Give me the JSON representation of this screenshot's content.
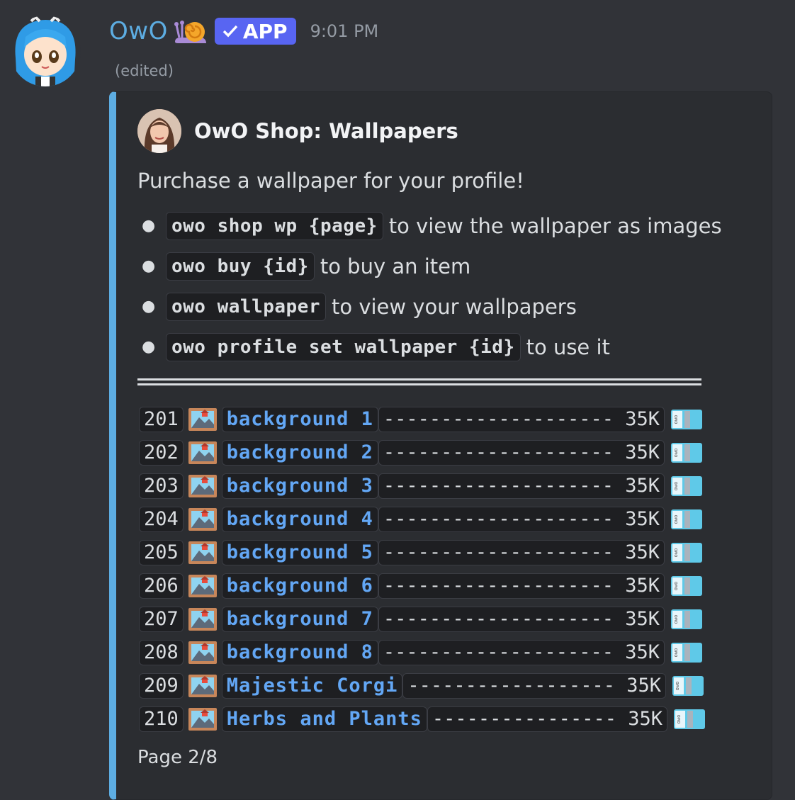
{
  "message": {
    "username": "OwO",
    "badge": "APP",
    "timestamp": "9:01 PM",
    "edited": "(edited)"
  },
  "embed": {
    "author": "OwO Shop: Wallpapers",
    "description": "Purchase a wallpaper for your profile!",
    "bullets": [
      {
        "code": "owo shop wp {page}",
        "text": "to view the wallpaper as images"
      },
      {
        "code": "owo buy {id}",
        "text": "to buy an item"
      },
      {
        "code": "owo wallpaper",
        "text": "to view your wallpapers"
      },
      {
        "code": "owo profile set wallpaper {id}",
        "text": "to use it"
      }
    ],
    "items": [
      {
        "id": "201",
        "name": "background 1",
        "dashes": "-------------------- 35K"
      },
      {
        "id": "202",
        "name": "background 2",
        "dashes": "-------------------- 35K"
      },
      {
        "id": "203",
        "name": "background 3",
        "dashes": "-------------------- 35K"
      },
      {
        "id": "204",
        "name": "background 4",
        "dashes": "-------------------- 35K"
      },
      {
        "id": "205",
        "name": "background 5",
        "dashes": "-------------------- 35K"
      },
      {
        "id": "206",
        "name": "background 6",
        "dashes": "-------------------- 35K"
      },
      {
        "id": "207",
        "name": "background 7",
        "dashes": "-------------------- 35K"
      },
      {
        "id": "208",
        "name": "background 8",
        "dashes": "-------------------- 35K"
      },
      {
        "id": "209",
        "name": "Majestic Corgi",
        "dashes": "------------------ 35K"
      },
      {
        "id": "210",
        "name": "Herbs and Plants",
        "dashes": "---------------- 35K"
      }
    ],
    "footer": "Page 2/8"
  },
  "icons": {
    "item_icon": "framed-picture-icon",
    "currency_icon": "owo-cash-icon",
    "accent": "#5dade2",
    "link_color": "#63a7f5"
  }
}
